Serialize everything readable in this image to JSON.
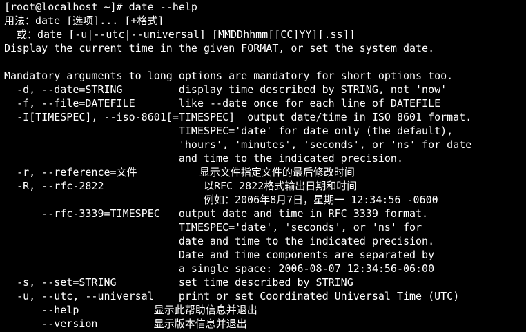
{
  "terminal": {
    "lines": [
      "[root@localhost ~]# date --help",
      "用法：date [选项]... [+格式]",
      "  或：date [-u|--utc|--universal] [MMDDhhmm[[CC]YY][.ss]]",
      "Display the current time in the given FORMAT, or set the system date.",
      "",
      "Mandatory arguments to long options are mandatory for short options too.",
      "  -d, --date=STRING         display time described by STRING, not 'now'",
      "  -f, --file=DATEFILE       like --date once for each line of DATEFILE",
      "  -I[TIMESPEC], --iso-8601[=TIMESPEC]  output date/time in ISO 8601 format.",
      "                            TIMESPEC='date' for date only (the default),",
      "                            'hours', 'minutes', 'seconds', or 'ns' for date",
      "                            and time to the indicated precision.",
      "  -r, --reference=文件          显示文件指定文件的最后修改时间",
      "  -R, --rfc-2822                以RFC 2822格式输出日期和时间",
      "                                例如：2006年8月7日，星期一 12:34:56 -0600",
      "      --rfc-3339=TIMESPEC   output date and time in RFC 3339 format.",
      "                            TIMESPEC='date', 'seconds', or 'ns' for",
      "                            date and time to the indicated precision.",
      "                            Date and time components are separated by",
      "                            a single space: 2006-08-07 12:34:56-06:00",
      "  -s, --set=STRING          set time described by STRING",
      "  -u, --utc, --universal    print or set Coordinated Universal Time (UTC)",
      "      --help            显示此帮助信息并退出",
      "      --version         显示版本信息并退出"
    ]
  }
}
